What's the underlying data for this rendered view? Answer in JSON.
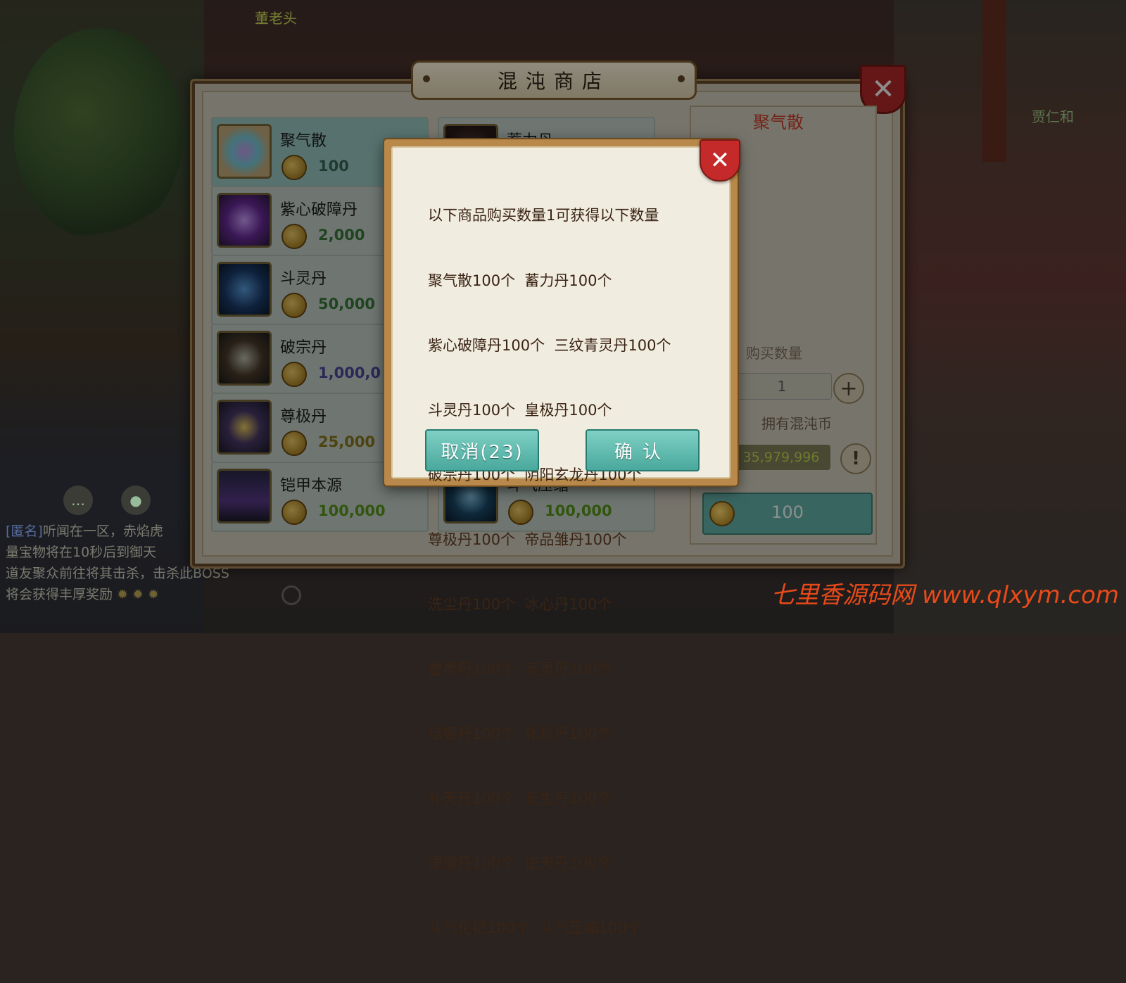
{
  "npcs": {
    "top": "董老头",
    "right": "贾仁和"
  },
  "shop": {
    "title": "混沌商店",
    "items": [
      {
        "name": "聚气散",
        "price": "100",
        "icon": "scroll-rainbow-icon"
      },
      {
        "name": "蓄力丹",
        "price": "",
        "icon": "pill-icon"
      },
      {
        "name": "紫心破障丹",
        "price": "2,000",
        "icon": "purple-orb-icon"
      },
      {
        "name": "斗灵丹",
        "price": "50,000",
        "icon": "blue-cauldron-icon"
      },
      {
        "name": "破宗丹",
        "price": "1,000,0",
        "icon": "dark-orb-icon"
      },
      {
        "name": "尊极丹",
        "price": "25,000",
        "icon": "gold-orb-icon"
      },
      {
        "name": "铠甲本源",
        "price": "100,000",
        "icon": "armor-icon"
      },
      {
        "name": "斗气压缩",
        "price": "100,000",
        "icon": "swirl-orb-icon"
      }
    ],
    "detail": {
      "name": "聚气散",
      "qty_label": "购买数量",
      "qty_value": "1",
      "own_label": "拥有混沌币",
      "own_value": "35,979,996",
      "buy_price": "100"
    }
  },
  "modal": {
    "lines": [
      "以下商品购买数量1可获得以下数量",
      "聚气散100个  蓄力丹100个",
      "紫心破障丹100个  三纹青灵丹100个",
      "斗灵丹100个  皇极丹100个",
      "破宗丹100个  阴阳玄龙丹100个",
      "尊极丹100个  帝品雏丹100个",
      "洗尘丹100个  冰心丹100个",
      "虚灵丹100个  定灵丹100个",
      "培婴丹100个  化形丹100个",
      "补天丹100个  长生丹100个",
      "涅槃丹100个  逆天丹100个",
      "斗气化铠100个  斗气压缩100个"
    ],
    "cancel_label": "取消(23)",
    "confirm_label": "确认"
  },
  "chat": {
    "line1_tag": "[匿名]",
    "line1": "听闻在一区，赤焰虎",
    "line2": "量宝物将在10秒后到御天",
    "line3": "道友聚众前往将其击杀，击杀此BOSS",
    "line4": "将会获得丰厚奖励"
  },
  "watermark": "七里香源码网 www.qlxym.com",
  "colors": {
    "accent_red": "#c42a2a",
    "button_teal": "#5fb8ac",
    "detail_red": "#c03a2a"
  }
}
